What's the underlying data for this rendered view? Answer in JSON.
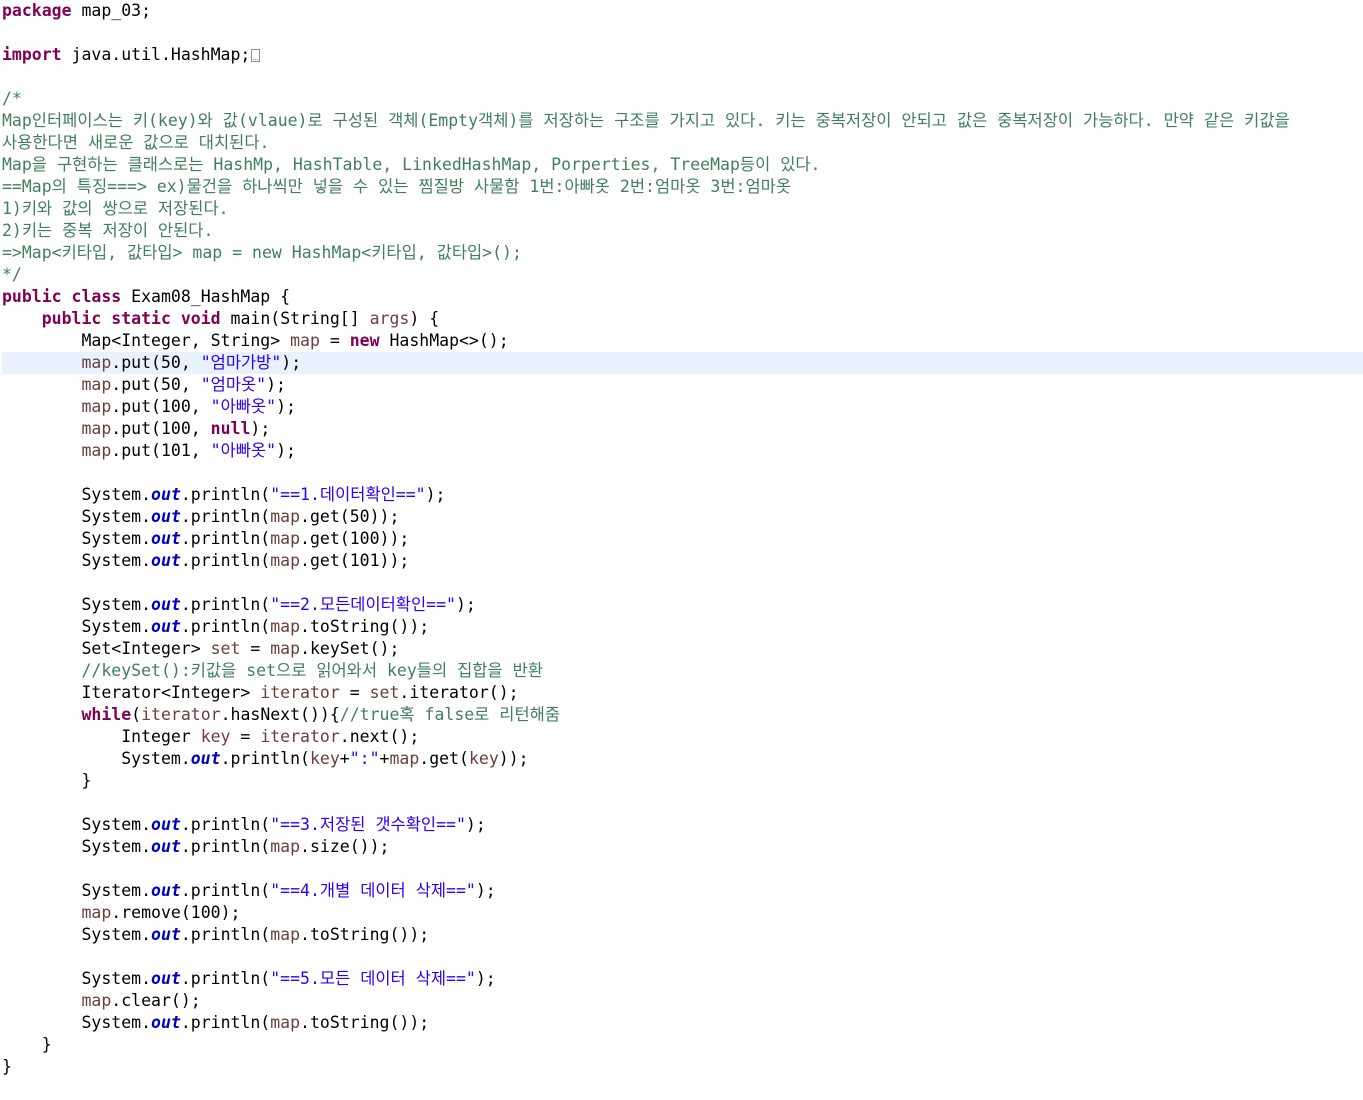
{
  "editor": {
    "language": "java",
    "current_line": 16,
    "folded_import_marker": "folded-imports",
    "colors": {
      "background": "#ffffff",
      "keyword": "#7f0055",
      "string": "#2a00ff",
      "comment": "#3f7f5f",
      "static_field": "#0000c0",
      "local_variable": "#6a3e3e",
      "current_line_highlight": "#e8f2fe"
    },
    "lines": [
      [
        [
          "kw",
          "package"
        ],
        [
          "p",
          " map_03;"
        ]
      ],
      [],
      [
        [
          "kw",
          "import"
        ],
        [
          "p",
          " java.util.HashMap;"
        ],
        [
          "fold",
          ""
        ]
      ],
      [],
      [
        [
          "cmt",
          "/*"
        ]
      ],
      [
        [
          "cmt",
          "Map인터페이스는 키(key)와 값(vlaue)로 구성된 객체(Empty객체)를 저장하는 구조를 가지고 있다. 키는 중복저장이 안되고 값은 중복저장이 가능하다. 만약 같은 키값을"
        ]
      ],
      [
        [
          "cmt",
          "사용한다면 새로운 값으로 대치된다."
        ]
      ],
      [
        [
          "cmt",
          "Map을 구현하는 클래스로는 HashMp, HashTable, LinkedHashMap, Porperties, TreeMap등이 있다."
        ]
      ],
      [
        [
          "cmt",
          "==Map의 특징===> ex)물건을 하나씩만 넣을 수 있는 찜질방 사물함 1번:아빠옷 2번:엄마옷 3번:엄마옷"
        ]
      ],
      [
        [
          "cmt",
          "1)키와 값의 쌍으로 저장된다."
        ]
      ],
      [
        [
          "cmt",
          "2)키는 중복 저장이 안된다."
        ]
      ],
      [
        [
          "cmt",
          "=>Map<키타입, 값타입> map = new HashMap<키타입, 값타입>();"
        ]
      ],
      [
        [
          "cmt",
          "*/"
        ]
      ],
      [
        [
          "kw",
          "public"
        ],
        [
          "p",
          " "
        ],
        [
          "kw",
          "class"
        ],
        [
          "p",
          " Exam08_HashMap {"
        ]
      ],
      [
        [
          "p",
          "    "
        ],
        [
          "kw",
          "public"
        ],
        [
          "p",
          " "
        ],
        [
          "kw",
          "static"
        ],
        [
          "p",
          " "
        ],
        [
          "kw",
          "void"
        ],
        [
          "p",
          " main(String[] "
        ],
        [
          "var",
          "args"
        ],
        [
          "p",
          ") {"
        ]
      ],
      [
        [
          "p",
          "        Map<Integer, String> "
        ],
        [
          "var",
          "map"
        ],
        [
          "p",
          " = "
        ],
        [
          "kw",
          "new"
        ],
        [
          "p",
          " HashMap<>();"
        ]
      ],
      [
        [
          "p",
          "        "
        ],
        [
          "var",
          "map"
        ],
        [
          "p",
          ".put(50, "
        ],
        [
          "str",
          "\"엄마가방\""
        ],
        [
          "p",
          ");"
        ]
      ],
      [
        [
          "p",
          "        "
        ],
        [
          "var",
          "map"
        ],
        [
          "p",
          ".put(50, "
        ],
        [
          "str",
          "\"엄마옷\""
        ],
        [
          "p",
          ");"
        ]
      ],
      [
        [
          "p",
          "        "
        ],
        [
          "var",
          "map"
        ],
        [
          "p",
          ".put(100, "
        ],
        [
          "str",
          "\"아빠옷\""
        ],
        [
          "p",
          ");"
        ]
      ],
      [
        [
          "p",
          "        "
        ],
        [
          "var",
          "map"
        ],
        [
          "p",
          ".put(100, "
        ],
        [
          "kw",
          "null"
        ],
        [
          "p",
          ");"
        ]
      ],
      [
        [
          "p",
          "        "
        ],
        [
          "var",
          "map"
        ],
        [
          "p",
          ".put(101, "
        ],
        [
          "str",
          "\"아빠옷\""
        ],
        [
          "p",
          ");"
        ]
      ],
      [],
      [
        [
          "p",
          "        System."
        ],
        [
          "field",
          "out"
        ],
        [
          "p",
          ".println("
        ],
        [
          "str",
          "\"==1.데이터확인==\""
        ],
        [
          "p",
          ");"
        ]
      ],
      [
        [
          "p",
          "        System."
        ],
        [
          "field",
          "out"
        ],
        [
          "p",
          ".println("
        ],
        [
          "var",
          "map"
        ],
        [
          "p",
          ".get(50));"
        ]
      ],
      [
        [
          "p",
          "        System."
        ],
        [
          "field",
          "out"
        ],
        [
          "p",
          ".println("
        ],
        [
          "var",
          "map"
        ],
        [
          "p",
          ".get(100));"
        ]
      ],
      [
        [
          "p",
          "        System."
        ],
        [
          "field",
          "out"
        ],
        [
          "p",
          ".println("
        ],
        [
          "var",
          "map"
        ],
        [
          "p",
          ".get(101));"
        ]
      ],
      [],
      [
        [
          "p",
          "        System."
        ],
        [
          "field",
          "out"
        ],
        [
          "p",
          ".println("
        ],
        [
          "str",
          "\"==2.모든데이터확인==\""
        ],
        [
          "p",
          ");"
        ]
      ],
      [
        [
          "p",
          "        System."
        ],
        [
          "field",
          "out"
        ],
        [
          "p",
          ".println("
        ],
        [
          "var",
          "map"
        ],
        [
          "p",
          ".toString());"
        ]
      ],
      [
        [
          "p",
          "        Set<Integer> "
        ],
        [
          "var",
          "set"
        ],
        [
          "p",
          " = "
        ],
        [
          "var",
          "map"
        ],
        [
          "p",
          ".keySet();"
        ]
      ],
      [
        [
          "p",
          "        "
        ],
        [
          "cmt",
          "//keySet():키값을 set으로 읽어와서 key들의 집합을 반환"
        ]
      ],
      [
        [
          "p",
          "        Iterator<Integer> "
        ],
        [
          "var",
          "iterator"
        ],
        [
          "p",
          " = "
        ],
        [
          "var",
          "set"
        ],
        [
          "p",
          ".iterator();"
        ]
      ],
      [
        [
          "p",
          "        "
        ],
        [
          "kw",
          "while"
        ],
        [
          "p",
          "("
        ],
        [
          "var",
          "iterator"
        ],
        [
          "p",
          ".hasNext()){"
        ],
        [
          "cmt",
          "//true혹 false로 리턴해줌"
        ]
      ],
      [
        [
          "p",
          "            Integer "
        ],
        [
          "var",
          "key"
        ],
        [
          "p",
          " = "
        ],
        [
          "var",
          "iterator"
        ],
        [
          "p",
          ".next();"
        ]
      ],
      [
        [
          "p",
          "            System."
        ],
        [
          "field",
          "out"
        ],
        [
          "p",
          ".println("
        ],
        [
          "var",
          "key"
        ],
        [
          "p",
          "+"
        ],
        [
          "str",
          "\":\""
        ],
        [
          "p",
          "+"
        ],
        [
          "var",
          "map"
        ],
        [
          "p",
          ".get("
        ],
        [
          "var",
          "key"
        ],
        [
          "p",
          "));"
        ]
      ],
      [
        [
          "p",
          "        }"
        ]
      ],
      [],
      [
        [
          "p",
          "        System."
        ],
        [
          "field",
          "out"
        ],
        [
          "p",
          ".println("
        ],
        [
          "str",
          "\"==3.저장된 갯수확인==\""
        ],
        [
          "p",
          ");"
        ]
      ],
      [
        [
          "p",
          "        System."
        ],
        [
          "field",
          "out"
        ],
        [
          "p",
          ".println("
        ],
        [
          "var",
          "map"
        ],
        [
          "p",
          ".size());"
        ]
      ],
      [],
      [
        [
          "p",
          "        System."
        ],
        [
          "field",
          "out"
        ],
        [
          "p",
          ".println("
        ],
        [
          "str",
          "\"==4.개별 데이터 삭제==\""
        ],
        [
          "p",
          ");"
        ]
      ],
      [
        [
          "p",
          "        "
        ],
        [
          "var",
          "map"
        ],
        [
          "p",
          ".remove(100);"
        ]
      ],
      [
        [
          "p",
          "        System."
        ],
        [
          "field",
          "out"
        ],
        [
          "p",
          ".println("
        ],
        [
          "var",
          "map"
        ],
        [
          "p",
          ".toString());"
        ]
      ],
      [],
      [
        [
          "p",
          "        System."
        ],
        [
          "field",
          "out"
        ],
        [
          "p",
          ".println("
        ],
        [
          "str",
          "\"==5.모든 데이터 삭제==\""
        ],
        [
          "p",
          ");"
        ]
      ],
      [
        [
          "p",
          "        "
        ],
        [
          "var",
          "map"
        ],
        [
          "p",
          ".clear();"
        ]
      ],
      [
        [
          "p",
          "        System."
        ],
        [
          "field",
          "out"
        ],
        [
          "p",
          ".println("
        ],
        [
          "var",
          "map"
        ],
        [
          "p",
          ".toString());"
        ]
      ],
      [
        [
          "p",
          "    }"
        ]
      ],
      [
        [
          "p",
          "}"
        ]
      ]
    ]
  }
}
